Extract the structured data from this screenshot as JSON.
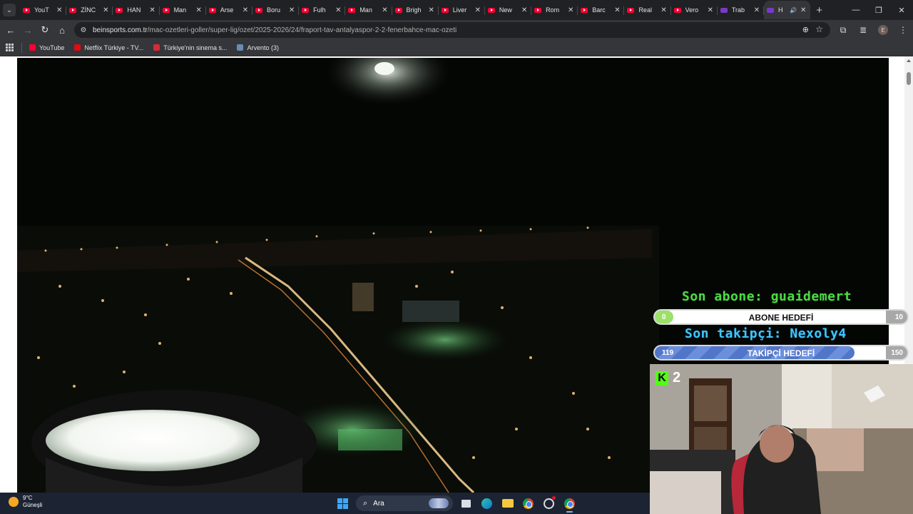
{
  "tabs": [
    {
      "title": "YouT",
      "icon": "youtube-icon"
    },
    {
      "title": "ZİNC",
      "icon": "youtube-icon"
    },
    {
      "title": "HAN",
      "icon": "youtube-icon"
    },
    {
      "title": "Man",
      "icon": "youtube-icon"
    },
    {
      "title": "Arse",
      "icon": "youtube-icon"
    },
    {
      "title": "Boru",
      "icon": "youtube-icon"
    },
    {
      "title": "Fulh",
      "icon": "youtube-icon"
    },
    {
      "title": "Man",
      "icon": "youtube-icon"
    },
    {
      "title": "Brigh",
      "icon": "youtube-icon"
    },
    {
      "title": "Liver",
      "icon": "youtube-icon"
    },
    {
      "title": "New",
      "icon": "youtube-icon"
    },
    {
      "title": "Rom",
      "icon": "youtube-icon"
    },
    {
      "title": "Barc",
      "icon": "youtube-icon"
    },
    {
      "title": "Real",
      "icon": "youtube-icon"
    },
    {
      "title": "Vero",
      "icon": "youtube-icon"
    },
    {
      "title": "Trab",
      "icon": "bein-icon"
    },
    {
      "title": "H",
      "icon": "bein-icon",
      "active": true,
      "audio": true
    }
  ],
  "address": {
    "domain": "beinsports.com.tr",
    "path": "/mac-ozetleri-goller/super-lig/ozet/2025-2026/24/fraport-tav-antalyaspor-2-2-fenerbahce-mac-ozeti"
  },
  "profile_initial": "E",
  "bookmarks": [
    {
      "label": "YouTube",
      "color": "#ff0033"
    },
    {
      "label": "Netflix Türkiye - TV...",
      "color": "#e50914"
    },
    {
      "label": "Türkiye'nin sinema s...",
      "color": "#d42b3b"
    },
    {
      "label": "Arvento (3)",
      "color": "#6b8ab8"
    }
  ],
  "overlay": {
    "last_sub": "Son abone: guaidemert",
    "sub_goal": {
      "label": "ABONE HEDEFİ",
      "current": "0",
      "max": "10",
      "progress": 0.0
    },
    "last_follower": "Son takipçi: Nexoly4",
    "follower_goal": {
      "label": "TAKİPÇİ HEDEFİ",
      "current": "119",
      "max": "150",
      "progress": 0.79
    }
  },
  "webcam": {
    "platform_badge": "K",
    "count": "2"
  },
  "taskbar": {
    "temperature": "9°C",
    "condition": "Güneşli",
    "search_placeholder": "Ara"
  },
  "colors": {
    "sub_text": "#4ddb45",
    "follower_text": "#3fc6ff",
    "kick_green": "#53fc18"
  }
}
